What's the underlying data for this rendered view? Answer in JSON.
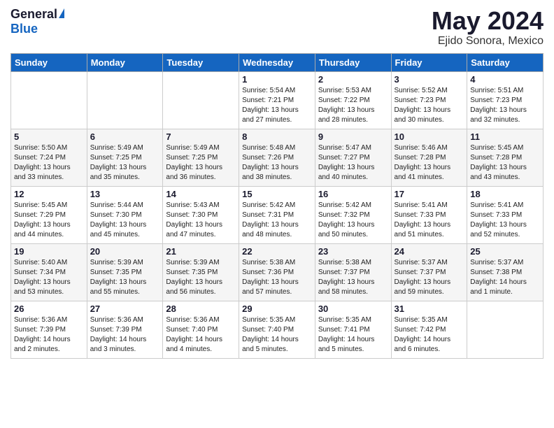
{
  "logo": {
    "general": "General",
    "blue": "Blue"
  },
  "header": {
    "month": "May 2024",
    "location": "Ejido Sonora, Mexico"
  },
  "weekdays": [
    "Sunday",
    "Monday",
    "Tuesday",
    "Wednesday",
    "Thursday",
    "Friday",
    "Saturday"
  ],
  "weeks": [
    [
      {
        "day": "",
        "sunrise": "",
        "sunset": "",
        "daylight": ""
      },
      {
        "day": "",
        "sunrise": "",
        "sunset": "",
        "daylight": ""
      },
      {
        "day": "",
        "sunrise": "",
        "sunset": "",
        "daylight": ""
      },
      {
        "day": "1",
        "sunrise": "Sunrise: 5:54 AM",
        "sunset": "Sunset: 7:21 PM",
        "daylight": "Daylight: 13 hours and 27 minutes."
      },
      {
        "day": "2",
        "sunrise": "Sunrise: 5:53 AM",
        "sunset": "Sunset: 7:22 PM",
        "daylight": "Daylight: 13 hours and 28 minutes."
      },
      {
        "day": "3",
        "sunrise": "Sunrise: 5:52 AM",
        "sunset": "Sunset: 7:23 PM",
        "daylight": "Daylight: 13 hours and 30 minutes."
      },
      {
        "day": "4",
        "sunrise": "Sunrise: 5:51 AM",
        "sunset": "Sunset: 7:23 PM",
        "daylight": "Daylight: 13 hours and 32 minutes."
      }
    ],
    [
      {
        "day": "5",
        "sunrise": "Sunrise: 5:50 AM",
        "sunset": "Sunset: 7:24 PM",
        "daylight": "Daylight: 13 hours and 33 minutes."
      },
      {
        "day": "6",
        "sunrise": "Sunrise: 5:49 AM",
        "sunset": "Sunset: 7:25 PM",
        "daylight": "Daylight: 13 hours and 35 minutes."
      },
      {
        "day": "7",
        "sunrise": "Sunrise: 5:49 AM",
        "sunset": "Sunset: 7:25 PM",
        "daylight": "Daylight: 13 hours and 36 minutes."
      },
      {
        "day": "8",
        "sunrise": "Sunrise: 5:48 AM",
        "sunset": "Sunset: 7:26 PM",
        "daylight": "Daylight: 13 hours and 38 minutes."
      },
      {
        "day": "9",
        "sunrise": "Sunrise: 5:47 AM",
        "sunset": "Sunset: 7:27 PM",
        "daylight": "Daylight: 13 hours and 40 minutes."
      },
      {
        "day": "10",
        "sunrise": "Sunrise: 5:46 AM",
        "sunset": "Sunset: 7:28 PM",
        "daylight": "Daylight: 13 hours and 41 minutes."
      },
      {
        "day": "11",
        "sunrise": "Sunrise: 5:45 AM",
        "sunset": "Sunset: 7:28 PM",
        "daylight": "Daylight: 13 hours and 43 minutes."
      }
    ],
    [
      {
        "day": "12",
        "sunrise": "Sunrise: 5:45 AM",
        "sunset": "Sunset: 7:29 PM",
        "daylight": "Daylight: 13 hours and 44 minutes."
      },
      {
        "day": "13",
        "sunrise": "Sunrise: 5:44 AM",
        "sunset": "Sunset: 7:30 PM",
        "daylight": "Daylight: 13 hours and 45 minutes."
      },
      {
        "day": "14",
        "sunrise": "Sunrise: 5:43 AM",
        "sunset": "Sunset: 7:30 PM",
        "daylight": "Daylight: 13 hours and 47 minutes."
      },
      {
        "day": "15",
        "sunrise": "Sunrise: 5:42 AM",
        "sunset": "Sunset: 7:31 PM",
        "daylight": "Daylight: 13 hours and 48 minutes."
      },
      {
        "day": "16",
        "sunrise": "Sunrise: 5:42 AM",
        "sunset": "Sunset: 7:32 PM",
        "daylight": "Daylight: 13 hours and 50 minutes."
      },
      {
        "day": "17",
        "sunrise": "Sunrise: 5:41 AM",
        "sunset": "Sunset: 7:33 PM",
        "daylight": "Daylight: 13 hours and 51 minutes."
      },
      {
        "day": "18",
        "sunrise": "Sunrise: 5:41 AM",
        "sunset": "Sunset: 7:33 PM",
        "daylight": "Daylight: 13 hours and 52 minutes."
      }
    ],
    [
      {
        "day": "19",
        "sunrise": "Sunrise: 5:40 AM",
        "sunset": "Sunset: 7:34 PM",
        "daylight": "Daylight: 13 hours and 53 minutes."
      },
      {
        "day": "20",
        "sunrise": "Sunrise: 5:39 AM",
        "sunset": "Sunset: 7:35 PM",
        "daylight": "Daylight: 13 hours and 55 minutes."
      },
      {
        "day": "21",
        "sunrise": "Sunrise: 5:39 AM",
        "sunset": "Sunset: 7:35 PM",
        "daylight": "Daylight: 13 hours and 56 minutes."
      },
      {
        "day": "22",
        "sunrise": "Sunrise: 5:38 AM",
        "sunset": "Sunset: 7:36 PM",
        "daylight": "Daylight: 13 hours and 57 minutes."
      },
      {
        "day": "23",
        "sunrise": "Sunrise: 5:38 AM",
        "sunset": "Sunset: 7:37 PM",
        "daylight": "Daylight: 13 hours and 58 minutes."
      },
      {
        "day": "24",
        "sunrise": "Sunrise: 5:37 AM",
        "sunset": "Sunset: 7:37 PM",
        "daylight": "Daylight: 13 hours and 59 minutes."
      },
      {
        "day": "25",
        "sunrise": "Sunrise: 5:37 AM",
        "sunset": "Sunset: 7:38 PM",
        "daylight": "Daylight: 14 hours and 1 minute."
      }
    ],
    [
      {
        "day": "26",
        "sunrise": "Sunrise: 5:36 AM",
        "sunset": "Sunset: 7:39 PM",
        "daylight": "Daylight: 14 hours and 2 minutes."
      },
      {
        "day": "27",
        "sunrise": "Sunrise: 5:36 AM",
        "sunset": "Sunset: 7:39 PM",
        "daylight": "Daylight: 14 hours and 3 minutes."
      },
      {
        "day": "28",
        "sunrise": "Sunrise: 5:36 AM",
        "sunset": "Sunset: 7:40 PM",
        "daylight": "Daylight: 14 hours and 4 minutes."
      },
      {
        "day": "29",
        "sunrise": "Sunrise: 5:35 AM",
        "sunset": "Sunset: 7:40 PM",
        "daylight": "Daylight: 14 hours and 5 minutes."
      },
      {
        "day": "30",
        "sunrise": "Sunrise: 5:35 AM",
        "sunset": "Sunset: 7:41 PM",
        "daylight": "Daylight: 14 hours and 5 minutes."
      },
      {
        "day": "31",
        "sunrise": "Sunrise: 5:35 AM",
        "sunset": "Sunset: 7:42 PM",
        "daylight": "Daylight: 14 hours and 6 minutes."
      },
      {
        "day": "",
        "sunrise": "",
        "sunset": "",
        "daylight": ""
      }
    ]
  ]
}
